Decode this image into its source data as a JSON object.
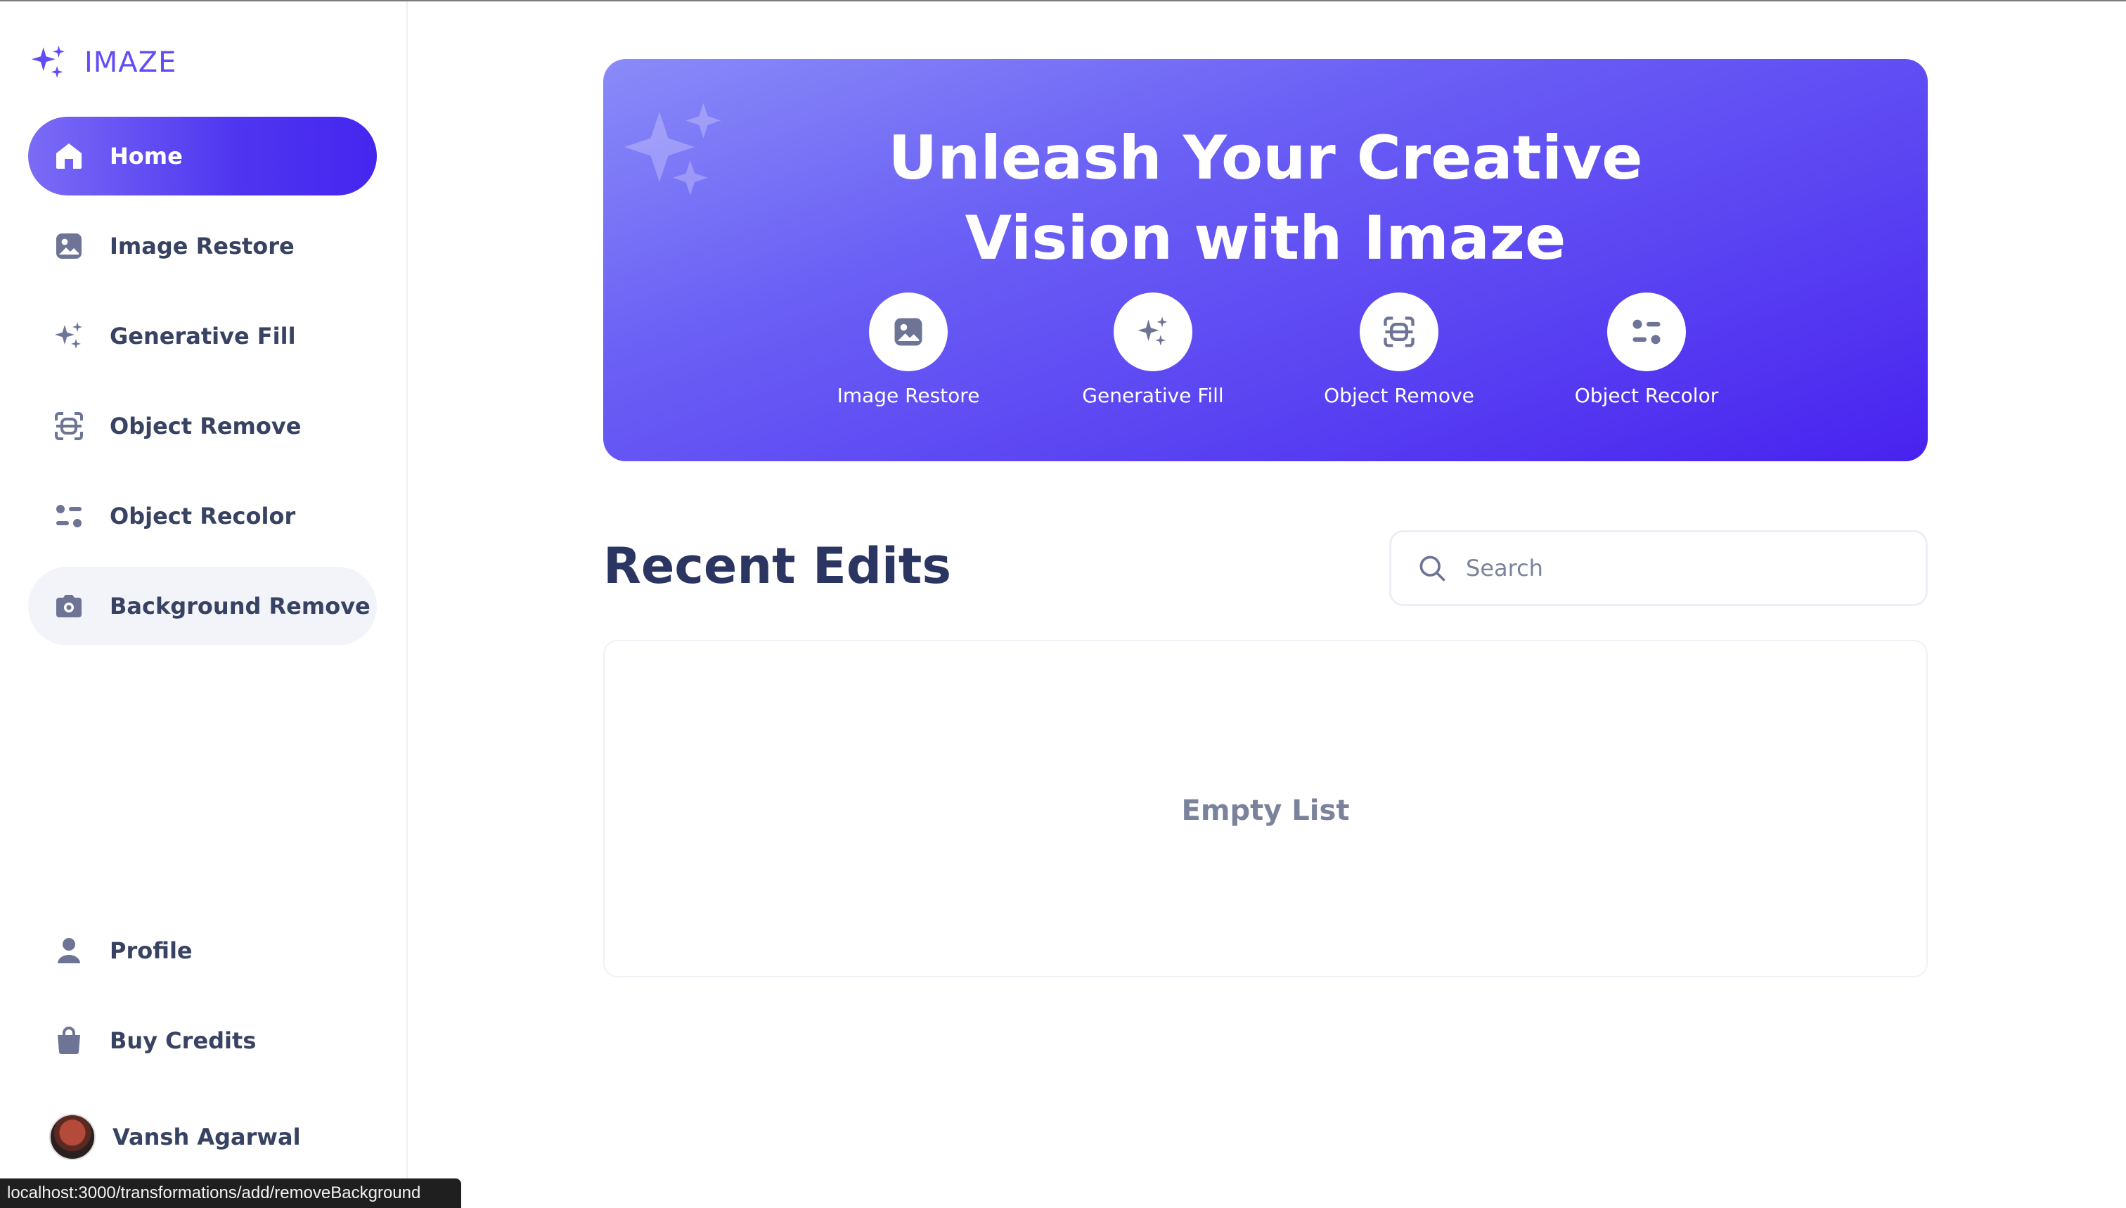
{
  "app": {
    "logo_text": "IMAZE"
  },
  "sidebar": {
    "items": [
      {
        "label": "Home",
        "icon": "home-icon",
        "active": true
      },
      {
        "label": "Image Restore",
        "icon": "image-icon"
      },
      {
        "label": "Generative Fill",
        "icon": "stars-icon"
      },
      {
        "label": "Object Remove",
        "icon": "scan-icon"
      },
      {
        "label": "Object Recolor",
        "icon": "filter-icon"
      },
      {
        "label": "Background Remove",
        "icon": "camera-icon",
        "hovered": true
      }
    ],
    "bottom_items": [
      {
        "label": "Profile",
        "icon": "profile-icon"
      },
      {
        "label": "Buy Credits",
        "icon": "bag-icon"
      }
    ],
    "user": {
      "name": "Vansh Agarwal"
    }
  },
  "hero": {
    "title_line1": "Unleash Your Creative",
    "title_line2": "Vision with Imaze",
    "shortcuts": [
      {
        "label": "Image Restore",
        "icon": "image-icon"
      },
      {
        "label": "Generative Fill",
        "icon": "stars-icon"
      },
      {
        "label": "Object Remove",
        "icon": "scan-icon"
      },
      {
        "label": "Object Recolor",
        "icon": "filter-icon"
      }
    ]
  },
  "recent": {
    "title": "Recent Edits",
    "search_placeholder": "Search",
    "empty_text": "Empty List"
  },
  "status_bar": {
    "url": "localhost:3000/transformations/add/removeBackground"
  },
  "colors": {
    "accent": "#4f35f0",
    "text_dark": "#2b3561",
    "text_muted": "#7b829b"
  }
}
